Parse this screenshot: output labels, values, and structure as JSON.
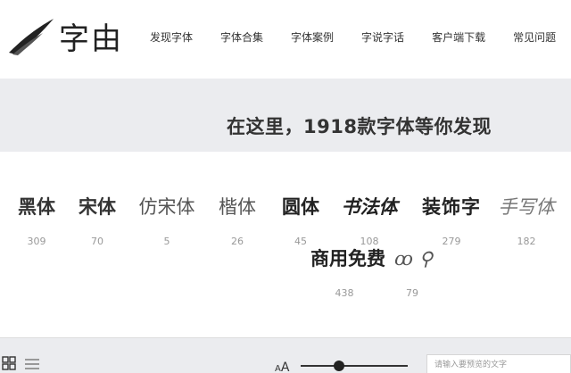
{
  "logo": {
    "text": "字由"
  },
  "nav": [
    "发现字体",
    "字体合集",
    "字体案例",
    "字说字话",
    "客户端下载",
    "常见问题"
  ],
  "banner": {
    "title": "在这里，1918款字体等你发现"
  },
  "categories": [
    {
      "name": "黑体",
      "count": "309"
    },
    {
      "name": "宋体",
      "count": "70"
    },
    {
      "name": "仿宋体",
      "count": "5"
    },
    {
      "name": "楷体",
      "count": "26"
    },
    {
      "name": "圆体",
      "count": "45"
    },
    {
      "name": "书法体",
      "count": "108"
    },
    {
      "name": "装饰字",
      "count": "279"
    },
    {
      "name": "手写体",
      "count": "182"
    },
    {
      "name": "商用免费",
      "count": "438"
    },
    {
      "name": "ꝏ ⚲",
      "count": "79"
    }
  ],
  "toolbar": {
    "aa_small": "A",
    "aa_big": "A",
    "preview_placeholder": "请输入要预览的文字"
  }
}
